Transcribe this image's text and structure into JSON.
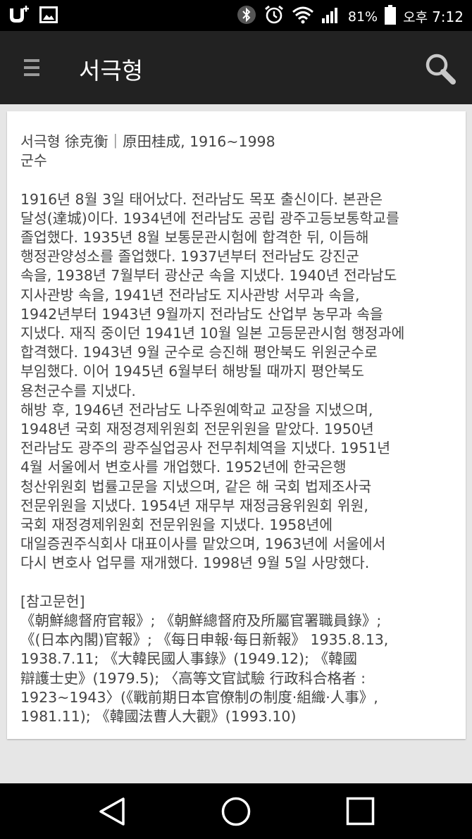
{
  "status_bar": {
    "battery": "81%",
    "ampm": "오후",
    "time": "7:12",
    "icons": [
      "u-plus-icon",
      "image-icon",
      "bluetooth-icon",
      "alarm-icon",
      "wifi-icon",
      "signal-icon",
      "battery-icon"
    ]
  },
  "app_bar": {
    "title": "서극형",
    "icons": [
      "menu-icon",
      "search-icon"
    ]
  },
  "article": {
    "header_lines": [
      "서극형 徐克衡｜原田桂成, 1916~1998",
      "군수"
    ],
    "body_lines": [
      "1916년 8월 3일 태어났다. 전라남도 목포 출신이다. 본관은",
      "달성(達城)이다. 1934년에 전라남도 공립 광주고등보통학교를",
      "졸업했다. 1935년 8월 보통문관시험에 합격한 뒤, 이듬해",
      "행정관양성소를 졸업했다. 1937년부터 전라남도 강진군",
      "속을, 1938년 7월부터 광산군 속을 지냈다. 1940년 전라남도",
      "지사관방 속을, 1941년 전라남도 지사관방 서무과 속을,",
      "1942년부터 1943년 9월까지 전라남도 산업부 농무과 속을",
      "지냈다. 재직 중이던 1941년 10월 일본 고등문관시험 행정과에",
      "합격했다. 1943년 9월 군수로 승진해 평안북도 위원군수로",
      "부임했다. 이어 1945년 6월부터 해방될 때까지 평안북도",
      "용천군수를 지냈다.",
      "해방 후, 1946년 전라남도 나주원예학교 교장을 지냈으며,",
      "1948년 국회 재정경제위원회 전문위원을 맡았다. 1950년",
      "전라남도 광주의 광주실업공사 전무취체역을 지냈다. 1951년",
      "4월 서울에서 변호사를 개업했다. 1952년에 한국은행",
      "청산위원회 법률고문을 지냈으며, 같은 해 국회 법제조사국",
      "전문위원을 지냈다. 1954년 재무부 재정금융위원회 위원,",
      "국회 재정경제위원회 전문위원을 지냈다. 1958년에",
      "대일증권주식회사 대표이사를 맡았으며, 1963년에 서울에서",
      "다시 변호사 업무를 재개했다. 1998년 9월 5일 사망했다."
    ],
    "ref_lines": [
      "[참고문헌]",
      "《朝鮮總督府官報》; 《朝鮮總督府及所屬官署職員錄》;",
      "《(日本內閣)官報》; 《每日申報·每日新報》 1935.8.13,",
      "1938.7.11; 《大韓民國人事錄》(1949.12); 《韓國",
      "辯護士史》(1979.5); 〈高等文官試驗 行政科合格者 :",
      "1923~1943〉(《戰前期日本官僚制の制度·組織·人事》,",
      "1981.11); 《韓國法曹人大觀》(1993.10)"
    ]
  },
  "nav_bar": {
    "icons": [
      "back-icon",
      "home-icon",
      "recents-icon"
    ]
  }
}
